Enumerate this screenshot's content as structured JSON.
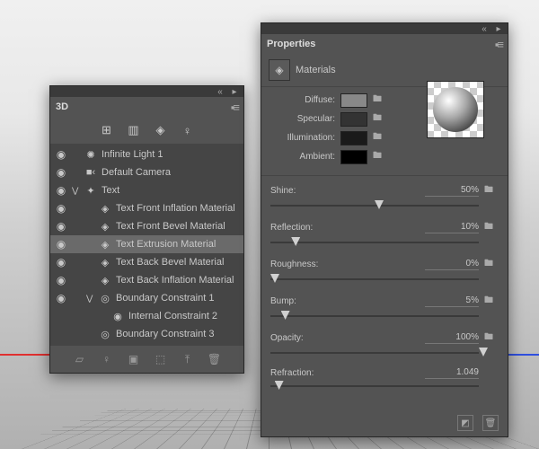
{
  "panel3d": {
    "title": "3D"
  },
  "tree": [
    {
      "eye": "◉",
      "indent": 0,
      "arrow": "",
      "icon": "✺",
      "label": "Infinite Light 1",
      "sel": false
    },
    {
      "eye": "◉",
      "indent": 0,
      "arrow": "",
      "icon": "■‹",
      "label": "Default Camera",
      "sel": false
    },
    {
      "eye": "◉",
      "indent": 0,
      "arrow": "⋁",
      "icon": "✦",
      "label": "Text",
      "sel": false
    },
    {
      "eye": "◉",
      "indent": 1,
      "arrow": "",
      "icon": "◈",
      "label": "Text Front Inflation Material",
      "sel": false
    },
    {
      "eye": "◉",
      "indent": 1,
      "arrow": "",
      "icon": "◈",
      "label": "Text Front Bevel Material",
      "sel": false
    },
    {
      "eye": "◉",
      "indent": 1,
      "arrow": "",
      "icon": "◈",
      "label": "Text Extrusion Material",
      "sel": true
    },
    {
      "eye": "◉",
      "indent": 1,
      "arrow": "",
      "icon": "◈",
      "label": "Text Back Bevel Material",
      "sel": false
    },
    {
      "eye": "◉",
      "indent": 1,
      "arrow": "",
      "icon": "◈",
      "label": "Text Back Inflation Material",
      "sel": false
    },
    {
      "eye": "◉",
      "indent": 1,
      "arrow": "⋁",
      "icon": "◎",
      "label": "Boundary Constraint 1",
      "sel": false
    },
    {
      "eye": "",
      "indent": 2,
      "arrow": "",
      "icon": "◉",
      "label": "Internal Constraint 2",
      "sel": false
    },
    {
      "eye": "",
      "indent": 1,
      "arrow": "",
      "icon": "◎",
      "label": "Boundary Constraint 3",
      "sel": false
    }
  ],
  "props": {
    "title": "Properties",
    "scope": "Materials",
    "swatches": [
      {
        "label": "Diffuse:",
        "cls": "sw-diff"
      },
      {
        "label": "Specular:",
        "cls": "sw-spec"
      },
      {
        "label": "Illumination:",
        "cls": "sw-illum"
      },
      {
        "label": "Ambient:",
        "cls": "sw-amb"
      }
    ],
    "sliders": [
      {
        "label": "Shine:",
        "value": "50%",
        "pos": 50,
        "folder": true
      },
      {
        "label": "Reflection:",
        "value": "10%",
        "pos": 10,
        "folder": true
      },
      {
        "label": "Roughness:",
        "value": "0%",
        "pos": 0,
        "folder": true
      },
      {
        "label": "Bump:",
        "value": "5%",
        "pos": 5,
        "folder": true
      },
      {
        "label": "Opacity:",
        "value": "100%",
        "pos": 100,
        "folder": true
      },
      {
        "label": "Refraction:",
        "value": "1.049",
        "pos": 2,
        "folder": false
      }
    ]
  }
}
